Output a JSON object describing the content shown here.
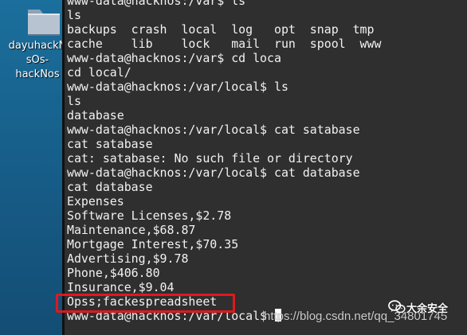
{
  "desktop": {
    "icon_label_lines": [
      "dayuhackN",
      "sOs-",
      "hackNos"
    ]
  },
  "terminal": {
    "lines": [
      "www-data@hacknos:/var$ ls",
      "ls",
      "backups  crash  local  log   opt  snap  tmp",
      "cache    lib    lock   mail  run  spool  www",
      "www-data@hacknos:/var$ cd loca",
      "cd local/",
      "www-data@hacknos:/var/local$ ls",
      "ls",
      "database",
      "www-data@hacknos:/var/local$ cat satabase",
      "cat satabase",
      "cat: satabase: No such file or directory",
      "www-data@hacknos:/var/local$ cat database",
      "cat database",
      "Expenses",
      "Software Licenses,$2.78",
      "Maintenance,$68.87",
      "Mortgage Interest,$70.35",
      "Advertising,$9.78",
      "Phone,$406.80",
      "Insurance,$9.04",
      "Opss;fackespreadsheet",
      "www-data@hacknos:/var/local$ "
    ]
  },
  "annotation": {
    "highlight_color": "#e0181d"
  },
  "watermark": {
    "url": "https://blog.csdn.net/qq_34801745",
    "brand": "大余安全",
    "icon": "wechat-icon"
  },
  "colors": {
    "terminal_background": "#2f2f2f",
    "terminal_text": "#f2f2f2",
    "desktop_background": "#175f8b"
  }
}
